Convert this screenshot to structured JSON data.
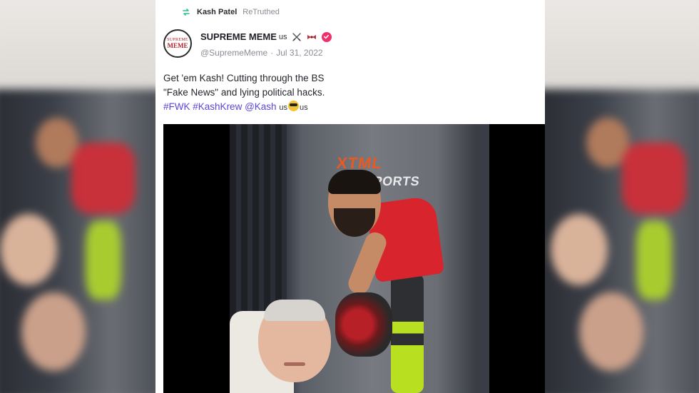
{
  "retruth": {
    "user": "Kash Patel",
    "label": "ReTruthed"
  },
  "post": {
    "avatar_text_top": "SUPREME",
    "avatar_text_bottom": "MEME",
    "display_name": "SUPREME MEME",
    "name_suffix": "us",
    "handle": "@SupremeMeme",
    "separator": "·",
    "date": "Jul 31, 2022",
    "text_line1": "Get 'em Kash! Cutting through the BS",
    "text_line2": "\"Fake News\" and lying political hacks.",
    "hashtag1": "#FWK",
    "hashtag2": "#KashKrew",
    "mention": "@Kash",
    "trail_us1": "us",
    "trail_us2": "us"
  },
  "media": {
    "brand_top": "XTML",
    "brand_bottom": "TORSPORTS"
  },
  "icons": {
    "retruth": "retruth-icon",
    "swords": "crossed-swords-icon",
    "tie": "bowtie-icon",
    "verified": "verified-badge-icon",
    "emoji": "sunglasses-emoji-icon"
  },
  "colors": {
    "hashtag": "#5a47d6",
    "verified": "#f0306a",
    "retruth_icon": "#2bbf8a",
    "brand_orange": "#e85a22"
  }
}
